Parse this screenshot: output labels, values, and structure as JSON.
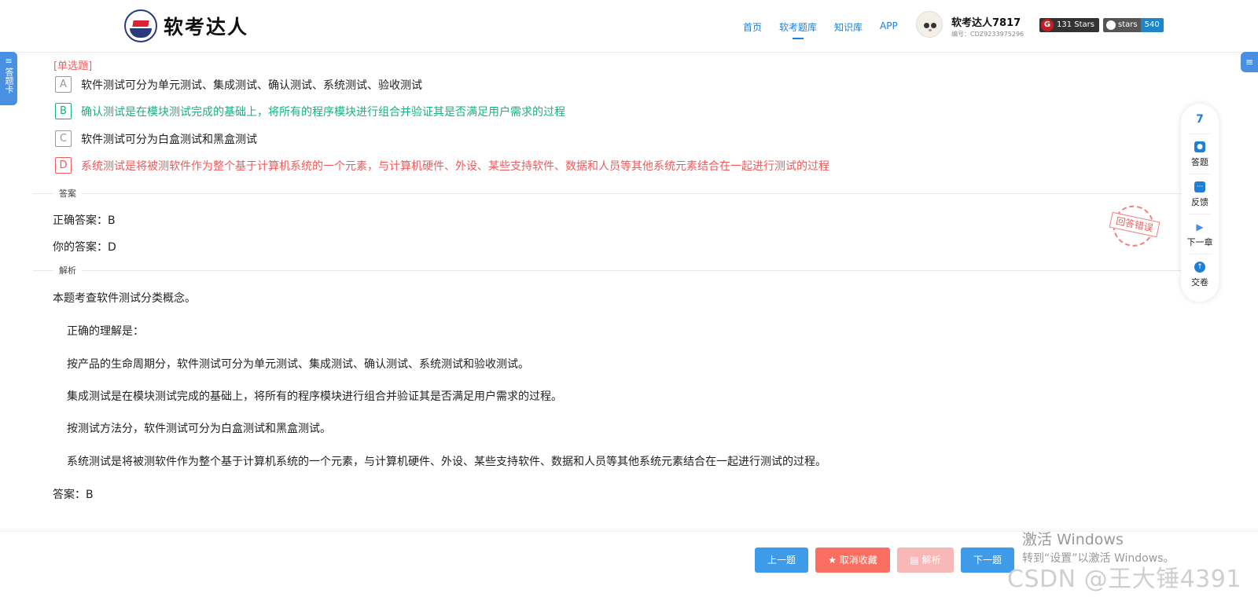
{
  "header": {
    "logo_text": "软考达人",
    "nav": [
      "首页",
      "软考题库",
      "知识库",
      "APP"
    ],
    "active_nav": "软考题库",
    "user_name": "软考达人7817",
    "user_id": "编号：CDZ9233975296",
    "gitee_badge": "131 Stars",
    "github_label": "stars",
    "github_count": "540"
  },
  "side_tab": {
    "icon": "≡",
    "label": "答题卡"
  },
  "right_tab": {
    "icon": "≡"
  },
  "question": {
    "type": "[单选题]",
    "options": [
      {
        "letter": "A",
        "text": "软件测试可分为单元测试、集成测试、确认测试、系统测试、验收测试",
        "state": "normal"
      },
      {
        "letter": "B",
        "text": "确认测试是在模块测试完成的基础上，将所有的程序模块进行组合并验证其是否满足用户需求的过程",
        "state": "correct"
      },
      {
        "letter": "C",
        "text": "软件测试可分为白盒测试和黑盒测试",
        "state": "normal"
      },
      {
        "letter": "D",
        "text": "系统测试是将被测软件作为整个基于计算机系统的一个元素，与计算机硬件、外设、某些支持软件、数据和人员等其他系统元素结合在一起进行测试的过程",
        "state": "wrong"
      }
    ]
  },
  "answer_section": {
    "label": "答案",
    "correct": "正确答案：B",
    "yours": "你的答案：D",
    "stamp": "回答错误"
  },
  "analysis_section": {
    "label": "解析",
    "intro": "本题考查软件测试分类概念。",
    "paragraphs": [
      "正确的理解是：",
      "按产品的生命周期分，软件测试可分为单元测试、集成测试、确认测试、系统测试和验收测试。",
      "集成测试是在模块测试完成的基础上，将所有的程序模块进行组合并验证其是否满足用户需求的过程。",
      "按测试方法分，软件测试可分为白盒测试和黑盒测试。",
      "系统测试是将被测软件作为整个基于计算机系统的一个元素，与计算机硬件、外设、某些支持软件、数据和人员等其他系统元素结合在一起进行测试的过程。"
    ],
    "answer": "答案：B"
  },
  "float_panel": {
    "number": "7",
    "items": [
      {
        "label": "答题",
        "icon": "answer-icon"
      },
      {
        "label": "反馈",
        "icon": "feedback-icon"
      },
      {
        "label": "下一章",
        "icon": "next-chapter-icon"
      },
      {
        "label": "交卷",
        "icon": "submit-icon"
      }
    ]
  },
  "footer": {
    "prev": "上一题",
    "fav": "★ 取消收藏",
    "analysis": "▤ 解析",
    "next": "下一题"
  },
  "watermarks": {
    "windows_line1": "激活 Windows",
    "windows_line2": "转到“设置”以激活 Windows。",
    "csdn": "CSDN @王大锤4391"
  },
  "colors": {
    "accent": "#1e7fd6",
    "correct": "#1bb07a",
    "wrong": "#f05a5a",
    "button_blue": "#3d9be9",
    "button_red": "#fb6f62"
  }
}
